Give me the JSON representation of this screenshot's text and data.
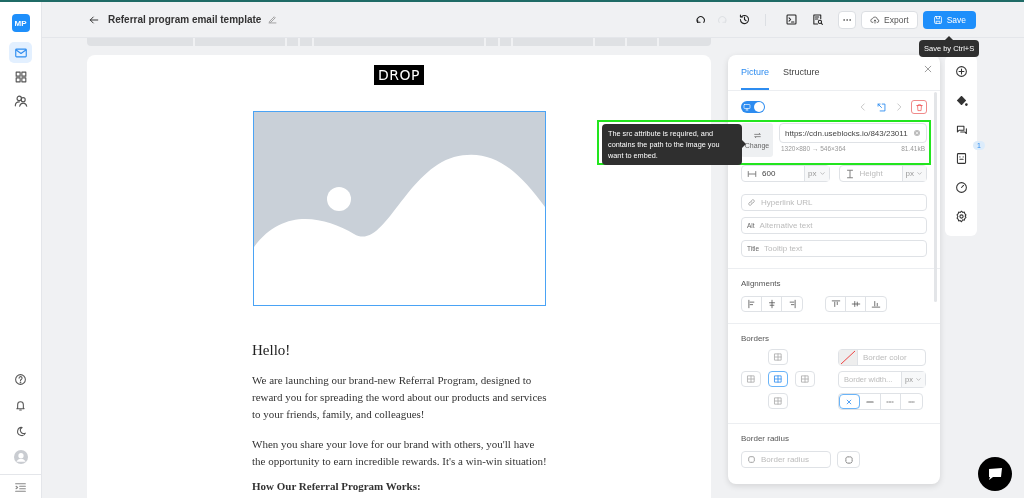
{
  "sidebar": {
    "logo": "MP",
    "nav_items": [
      {
        "selected": true
      },
      {
        "selected": false
      },
      {
        "selected": false
      }
    ]
  },
  "header": {
    "title": "Referral program email template",
    "history": [
      {
        "disabled": false
      },
      {
        "disabled": true
      },
      {
        "disabled": false
      }
    ],
    "export": "Export",
    "save": "Save",
    "save_tooltip": "Save by Ctrl+S"
  },
  "email": {
    "logo": "DROP",
    "image_selected": true,
    "greeting": "Hello!",
    "paragraphs": [
      "We are launching our brand-new Referral Program, designed to reward you for spreading the word about our products and services to your friends, family, and colleagues!",
      "When you share your love for our brand with others, you'll have the opportunity to earn incredible rewards. It's a win-win situation!"
    ],
    "subheading": "How Our Referral Program Works:"
  },
  "panel": {
    "tabs": [
      {
        "label": "Picture",
        "selected": true
      },
      {
        "label": "Structure",
        "selected": false
      }
    ],
    "toggle_on": true,
    "src": {
      "change": "Change",
      "value": "https://cdn.useblocks.io/843/23011",
      "dimensions": "1320×880 → 546×364",
      "size": "81.41kB",
      "tooltip": "The src attribute is required, and contains the path to the image you want to embed."
    },
    "width": {
      "value": "600",
      "unit": "px"
    },
    "height": {
      "placeholder": "Height",
      "unit": "px"
    },
    "hyperlink": {
      "placeholder": "Hyperlink URL"
    },
    "alt": {
      "prefix": "Alt",
      "placeholder": "Alternative text"
    },
    "title_field": {
      "prefix": "Title",
      "placeholder": "Tooltip text"
    },
    "alignments": {
      "heading": "Alignments"
    },
    "borders": {
      "heading": "Borders",
      "sides": [
        {
          "selected": false
        },
        {
          "selected": false
        },
        {
          "selected": true
        },
        {
          "selected": false
        },
        {
          "selected": false
        }
      ],
      "color_placeholder": "Border color",
      "width_placeholder": "Border width...",
      "unit": "px",
      "styles": [
        {
          "selected": true
        },
        {
          "selected": false
        },
        {
          "selected": false
        },
        {
          "selected": false
        }
      ]
    },
    "border_radius": {
      "heading": "Border radius",
      "placeholder": "Border radius"
    }
  },
  "rail": {
    "badge": "1"
  }
}
